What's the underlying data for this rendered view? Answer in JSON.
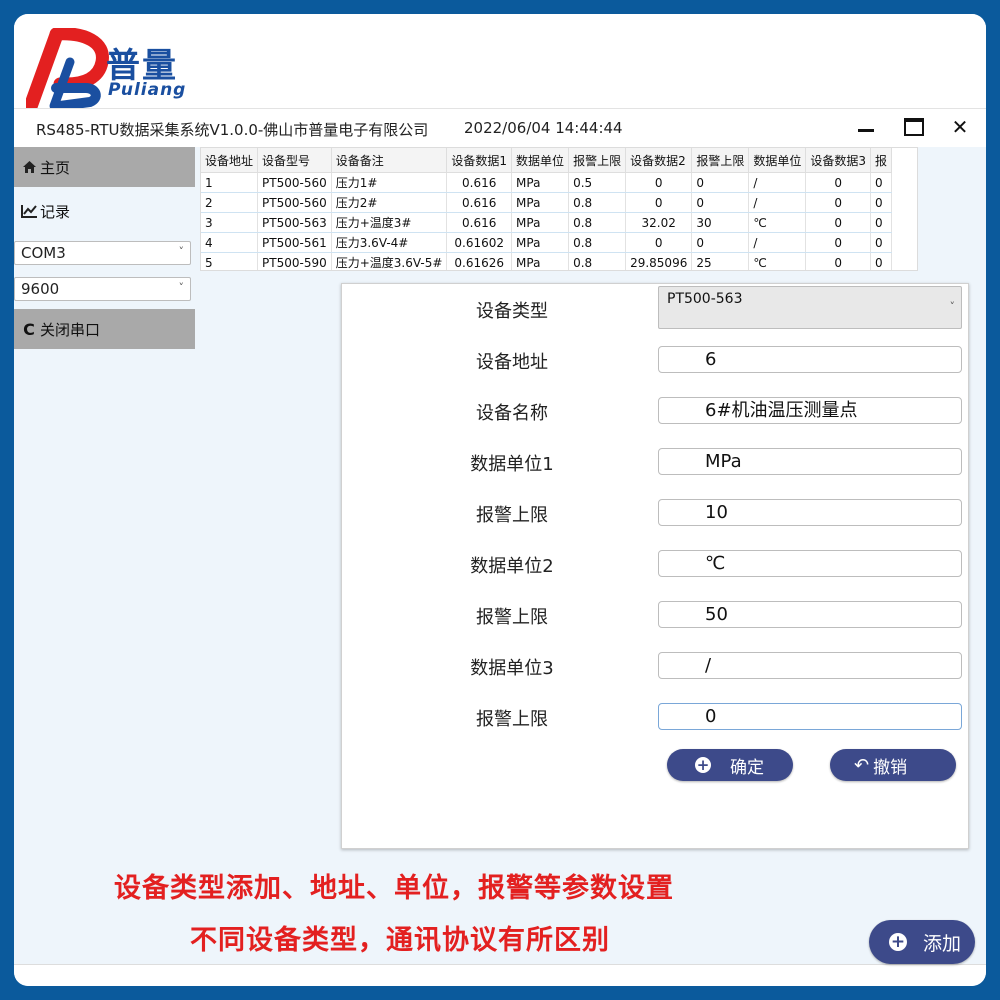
{
  "brand": {
    "name_cn": "普量",
    "name_en": "Puliang"
  },
  "titlebar": {
    "title": "RS485-RTU数据采集系统V1.0.0-佛山市普量电子有限公司",
    "datetime": "2022/06/04 14:44:44"
  },
  "sidebar": {
    "items": [
      {
        "label": "主页",
        "icon": "home-icon"
      },
      {
        "label": "记录",
        "icon": "line-chart-icon"
      }
    ],
    "port_select": "COM3",
    "baud_select": "9600",
    "close_port_label": "关闭串口"
  },
  "table": {
    "headers": [
      "设备地址",
      "设备型号",
      "设备备注",
      "设备数据1",
      "数据单位",
      "报警上限",
      "设备数据2",
      "报警上限",
      "数据单位",
      "设备数据3",
      "报"
    ],
    "rows": [
      [
        "1",
        "PT500-560",
        "压力1#",
        "0.616",
        "MPa",
        "0.5",
        "0",
        "0",
        "/",
        "0",
        "0"
      ],
      [
        "2",
        "PT500-560",
        "压力2#",
        "0.616",
        "MPa",
        "0.8",
        "0",
        "0",
        "/",
        "0",
        "0"
      ],
      [
        "3",
        "PT500-563",
        "压力+温度3#",
        "0.616",
        "MPa",
        "0.8",
        "32.02",
        "30",
        "℃",
        "0",
        "0"
      ],
      [
        "4",
        "PT500-561",
        "压力3.6V-4#",
        "0.61602",
        "MPa",
        "0.8",
        "0",
        "0",
        "/",
        "0",
        "0"
      ],
      [
        "5",
        "PT500-590",
        "压力+温度3.6V-5#",
        "0.61626",
        "MPa",
        "0.8",
        "29.85096",
        "25",
        "℃",
        "0",
        "0"
      ]
    ],
    "alarm_cells": [
      [
        0,
        3
      ],
      [
        2,
        6
      ],
      [
        4,
        6
      ]
    ]
  },
  "form": {
    "device_type_label": "设备类型",
    "device_type_value": "PT500-563",
    "fields": [
      {
        "label": "设备地址",
        "value": "6"
      },
      {
        "label": "设备名称",
        "value": "6#机油温压测量点"
      },
      {
        "label": "数据单位1",
        "value": "MPa"
      },
      {
        "label": "报警上限",
        "value": "10"
      },
      {
        "label": "数据单位2",
        "value": "℃"
      },
      {
        "label": "报警上限",
        "value": "50"
      },
      {
        "label": "数据单位3",
        "value": "/"
      },
      {
        "label": "报警上限",
        "value": "0"
      }
    ],
    "confirm_label": "确定",
    "cancel_label": "撤销"
  },
  "overlay": {
    "line1": "设备类型添加、地址、单位，报警等参数设置",
    "line2": "不同设备类型，通讯协议有所区别"
  },
  "add_button_label": "添加",
  "colors": {
    "brand_blue": "#1a4fa0",
    "brand_red": "#e32020",
    "button_navy": "#3d4a8a",
    "alarm_red": "#e53935"
  }
}
